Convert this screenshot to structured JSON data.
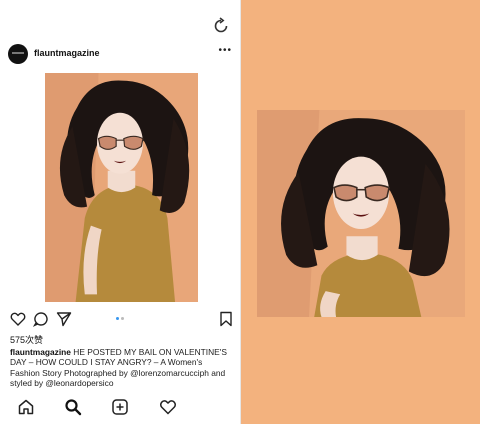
{
  "post": {
    "username": "flauntmagazine",
    "more_label": "•••",
    "likes": "575次赞",
    "caption_username": "flauntmagazine",
    "caption_text": " HE POSTED MY BAIL ON VALENTINE'S DAY – HOW COULD I STAY ANGRY? – A Women's Fashion Story Photographed by @lorenzomarcucciph and styled by @leonardopersico",
    "carousel_position": 1,
    "carousel_count": 2
  },
  "icons": {
    "refresh": "refresh-icon",
    "like": "heart-icon",
    "comment": "comment-icon",
    "share": "send-icon",
    "save": "bookmark-icon",
    "tabs": [
      "home-icon",
      "search-icon",
      "add-post-icon",
      "activity-heart-icon"
    ]
  },
  "colors": {
    "preview_background": "#f3b27e",
    "photo_background": "#e9a87a",
    "avatar": "#111111"
  }
}
